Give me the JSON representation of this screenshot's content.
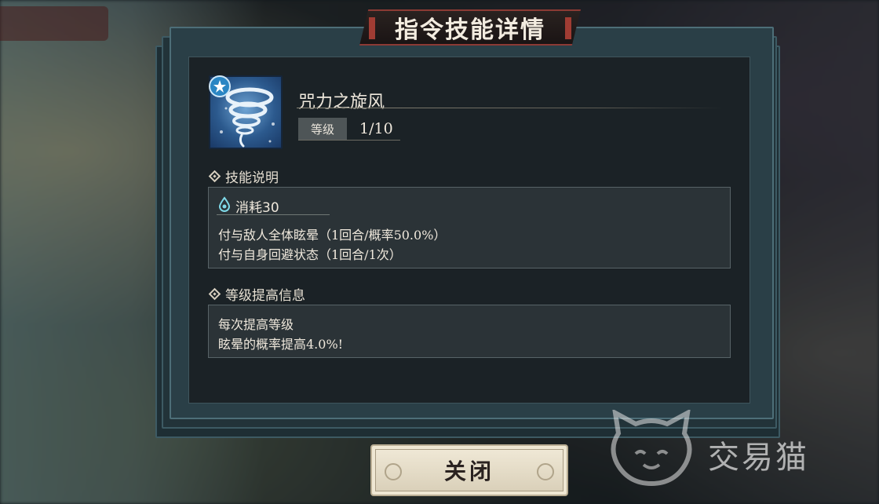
{
  "dialog": {
    "title": "指令技能详情"
  },
  "skill": {
    "name": "咒力之旋风",
    "icon": "whirlwind-icon",
    "level_label": "等级",
    "level_value": "1/10"
  },
  "skill_description": {
    "heading": "技能说明",
    "cost": "消耗30",
    "cost_icon": "mana-drop-icon",
    "lines": [
      "付与敌人全体眩晕（1回合/概率50.0%）",
      "付与自身回避状态（1回合/1次）"
    ]
  },
  "level_up_info": {
    "heading": "等级提高信息",
    "lines": [
      "每次提高等级",
      "眩晕的概率提高4.0%!"
    ]
  },
  "close_button": {
    "label": "关闭"
  },
  "watermark": {
    "text": "交易猫"
  },
  "colors": {
    "banner_accent": "#8c3a34",
    "panel_bg": "#1b2226",
    "box_bg": "#2b3337",
    "frame_teal": "#4d6e78",
    "button_bg": "#e6ddc8"
  }
}
